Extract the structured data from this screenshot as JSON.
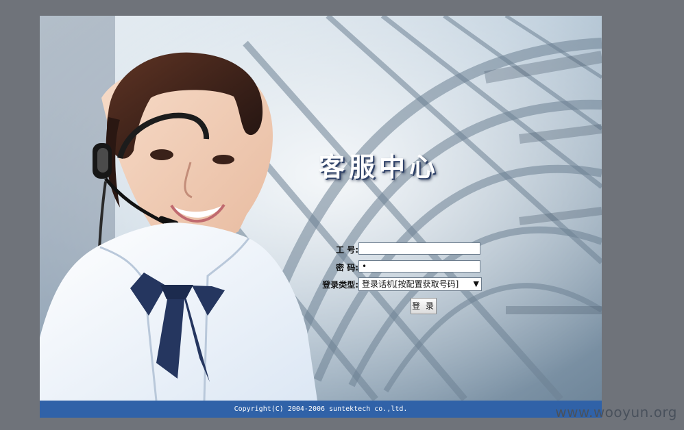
{
  "title": "客服中心",
  "form": {
    "employee_id_label": "工 号:",
    "employee_id_value": "",
    "password_label": "密 码:",
    "password_value": "•",
    "login_type_label": "登录类型:",
    "login_type_value": "登录话机[按配置获取号码]",
    "login_button_label": "登 录"
  },
  "footer": {
    "copyright": "Copyright(C) 2004-2006 suntektech co.,ltd."
  },
  "watermark": "www.wooyun.org"
}
